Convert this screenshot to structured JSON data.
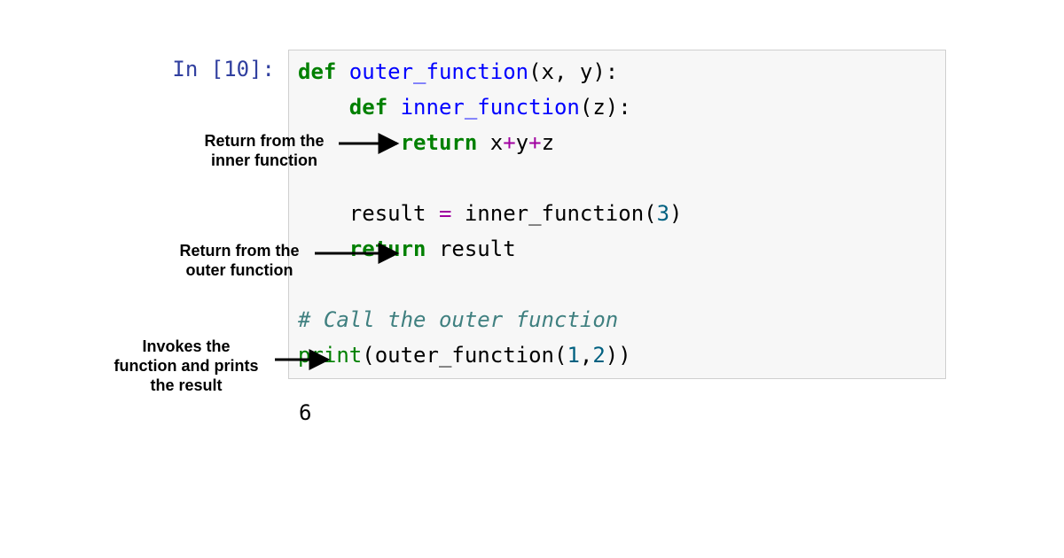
{
  "prompt": "In [10]:",
  "code": {
    "l1": {
      "kw": "def ",
      "fn": "outer_function",
      "rest": "(x, y):"
    },
    "l2": {
      "indent": "    ",
      "kw": "def ",
      "fn": "inner_function",
      "rest": "(z):"
    },
    "l3": {
      "indent": "        ",
      "kw": "return ",
      "a": "x",
      "op1": "+",
      "b": "y",
      "op2": "+",
      "c": "z"
    },
    "l4": "",
    "l5": {
      "indent": "    result ",
      "eq": "=",
      "rest": " inner_function(",
      "num": "3",
      "close": ")"
    },
    "l6": {
      "indent": "    ",
      "kw": "return ",
      "rest": "result"
    },
    "l7": "",
    "l8": {
      "indent": "",
      "comment": "# Call the outer function"
    },
    "l9": {
      "builtin": "print",
      "open": "(outer_function(",
      "n1": "1",
      "comma": ",",
      "n2": "2",
      "close": "))"
    }
  },
  "output": "6",
  "annotations": {
    "a1": "Return from the\ninner function",
    "a2": "Return from the\nouter function",
    "a3": "Invokes the\nfunction and prints\nthe result"
  }
}
